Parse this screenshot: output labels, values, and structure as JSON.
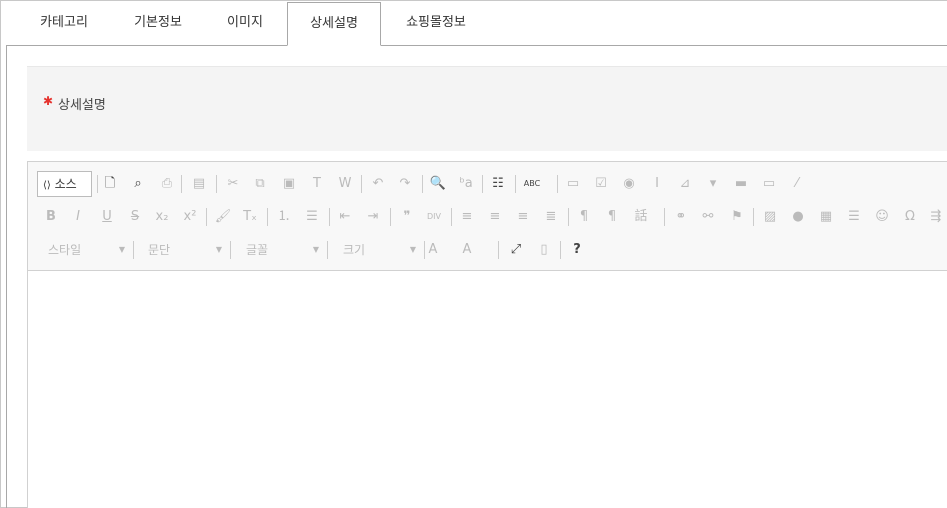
{
  "tabs": [
    {
      "label": "카테고리"
    },
    {
      "label": "기본정보"
    },
    {
      "label": "이미지"
    },
    {
      "label": "상세설명",
      "active": true
    },
    {
      "label": "쇼핑몰정보"
    }
  ],
  "section": {
    "required_mark": "✱",
    "label": "상세설명"
  },
  "editor": {
    "source_label": "소스",
    "combos": {
      "style": "스타일",
      "format": "문단",
      "font": "글꼴",
      "size": "크기"
    },
    "icons": {
      "newpage": "🗋",
      "preview": "⌕",
      "print": "⎙",
      "templates": "▤",
      "cut": "✂",
      "copy": "⧉",
      "paste": "▣",
      "paste_text": "T",
      "paste_word": "W",
      "undo": "↶",
      "redo": "↷",
      "find": "🔍",
      "replace": "ᵇa",
      "selectall": "☷",
      "spell": "ABC",
      "form": "▭",
      "checkbox": "☑",
      "radio": "◉",
      "textfield": "I",
      "textarea": "⊿",
      "select": "▾",
      "button": "▬",
      "imagebutton": "▭",
      "hidden": "⁄",
      "bold": "B",
      "italic": "I",
      "underline": "U",
      "strike": "S",
      "sub": "x₂",
      "sup": "x²",
      "copyformat": "🖌",
      "removeformat": "Tₓ",
      "ol": "⒈",
      "ul": "☰",
      "outdent": "⇤",
      "indent": "⇥",
      "blockquote": "❞",
      "div": "DIV",
      "left": "≡",
      "center": "≡",
      "right": "≡",
      "justify": "≣",
      "ltr": "¶",
      "rtl": "¶",
      "lang": "話",
      "link": "⚭",
      "unlink": "⚯",
      "anchor": "⚑",
      "image": "▨",
      "flash": "●",
      "table": "▦",
      "hr": "☰",
      "smiley": "☺",
      "specialchar": "Ω",
      "pagebreak": "⇶",
      "textcolor": "A",
      "bgcolor": "A",
      "maximize": "⤢",
      "showblocks": "▯",
      "about": "?"
    }
  },
  "colors": {
    "required": "#e5322d",
    "panel_bg": "#f4f4f4",
    "toolbar_bg": "#f8f8f8"
  }
}
